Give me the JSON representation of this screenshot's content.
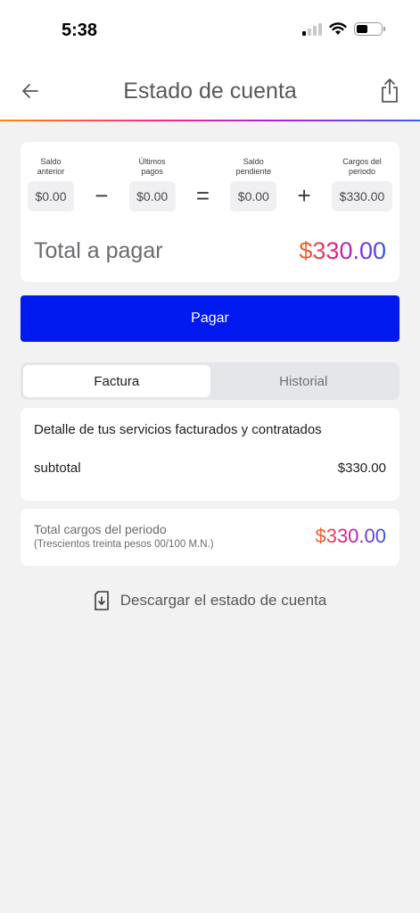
{
  "status": {
    "time": "5:38",
    "icons": [
      "cellular-signal-icon",
      "wifi-icon",
      "battery-icon"
    ]
  },
  "header": {
    "title": "Estado de cuenta",
    "back_icon": "arrow-left-icon",
    "share_icon": "share-icon"
  },
  "summary": {
    "items": [
      {
        "label": "Saldo anterior",
        "value": "$0.00"
      },
      {
        "label": "Últimos pagos",
        "value": "$0.00"
      },
      {
        "label": "Saldo pendiente",
        "value": "$0.00"
      },
      {
        "label": "Cargos del periodo",
        "value": "$330.00"
      }
    ],
    "operators": [
      "−",
      "=",
      "+"
    ],
    "total_label": "Total a pagar",
    "total_amount": "$330.00"
  },
  "pay_button": {
    "label": "Pagar"
  },
  "tabs": [
    {
      "label": "Factura",
      "active": true
    },
    {
      "label": "Historial",
      "active": false
    }
  ],
  "detail": {
    "title": "Detalle de tus servicios facturados y contratados",
    "rows": [
      {
        "label": "subtotal",
        "value": "$330.00"
      }
    ]
  },
  "totals": {
    "label": "Total cargos del periodo",
    "sublabel": "(Trescientos treinta pesos 00/100 M.N.)",
    "amount": "$330.00"
  },
  "download": {
    "label": "Descargar el estado de cuenta",
    "icon": "download-document-icon"
  },
  "colors": {
    "primary": "#0019ee",
    "background": "#f2f2f3",
    "gradient": [
      "#f46a1f",
      "#e0227a",
      "#8a2be2",
      "#2f5bd8"
    ]
  }
}
